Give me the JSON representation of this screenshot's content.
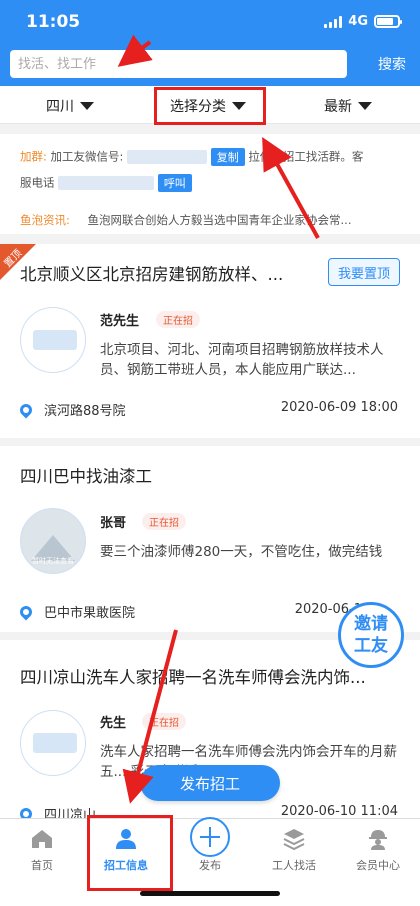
{
  "status_bar": {
    "time": "11:05",
    "network": "4G"
  },
  "search": {
    "placeholder": "找活、找工作",
    "button": "搜索"
  },
  "filters": [
    {
      "label": "四川"
    },
    {
      "label": "选择分类"
    },
    {
      "label": "最新"
    }
  ],
  "notice": {
    "group_label": "加群:",
    "group_text_1": "加工友微信号:",
    "copy_button": "复制",
    "group_text_2": "拉你进招工找活群。客",
    "service_label": "服电话",
    "call_button": "呼叫",
    "news_label": "鱼泡资讯:",
    "news_text": "鱼泡网联合创始人方毅当选中国青年企业家协会常..."
  },
  "jobs": [
    {
      "pinned_tag": "置顶",
      "title": "北京顺义区北京招房建钢筋放样、...",
      "pin_button": "我要置顶",
      "poster": "范先生",
      "status": "正在招",
      "desc": "北京项目、河北、河南项目招聘钢筋放样技术人员、钢筋工带班人员，本人能应用广联达...",
      "location": "滨河路88号院",
      "datetime": "2020-06-09 18:00"
    },
    {
      "title": "四川巴中找油漆工",
      "poster": "张哥",
      "status": "正在招",
      "desc": "要三个油漆师傅280一天，不管吃住，做完结钱",
      "location": "巴中市果敢医院",
      "datetime": "2020-06-1",
      "avatar_caption": "暂时无法查看"
    },
    {
      "title": "四川凉山洗车人家招聘一名洗车师傅会洗内饰...",
      "poster": "先生",
      "status": "正在招",
      "desc": "洗车人家招聘一名洗车师傅会洗内饰会开车的月薪五... 彩云府附近，...",
      "location": "四川凉山",
      "datetime": "2020-06-10 11:04"
    }
  ],
  "invite_button": {
    "line1": "邀请",
    "line2": "工友"
  },
  "publish_button": "发布招工",
  "tabs": [
    {
      "label": "首页",
      "icon": "home-icon"
    },
    {
      "label": "招工信息",
      "icon": "workers-icon"
    },
    {
      "label": "发布",
      "icon": "plus-icon"
    },
    {
      "label": "工人找活",
      "icon": "stack-icon"
    },
    {
      "label": "会员中心",
      "icon": "worker-helmet-icon"
    }
  ],
  "colors": {
    "primary": "#2f8ef4",
    "accent_red": "#e4582e",
    "annotation": "#e5201f"
  }
}
